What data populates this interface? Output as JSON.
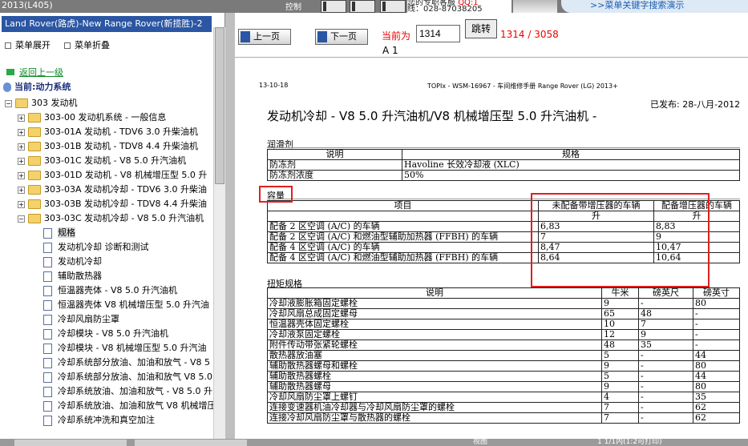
{
  "window": {
    "title": "2013(L405)",
    "control_label": "控制"
  },
  "ad": {
    "line1": "您的专职客服",
    "qq": "QQ:1",
    "line2": "线：028-87038205",
    "link": ">>菜单关键字搜索演示"
  },
  "left": {
    "header": "Land Rover(路虎)-New Range Rover(新揽胜)-2",
    "expand_label": "菜单展开",
    "collapse_label": "菜单折叠",
    "back_label": "返回上一级",
    "current_label": "当前:动力系统",
    "tree": [
      {
        "label": "303 发动机",
        "type": "folder",
        "open": true,
        "indent": 0
      },
      {
        "label": "303-00 发动机系统 - 一般信息",
        "type": "folder",
        "indent": 1
      },
      {
        "label": "303-01A 发动机 - TDV6 3.0 升柴油机",
        "type": "folder",
        "indent": 1
      },
      {
        "label": "303-01B 发动机 - TDV8 4.4 升柴油机",
        "type": "folder",
        "indent": 1
      },
      {
        "label": "303-01C 发动机 - V8 5.0 升汽油机",
        "type": "folder",
        "indent": 1
      },
      {
        "label": "303-01D 发动机 - V8 机械增压型 5.0 升",
        "type": "folder",
        "indent": 1
      },
      {
        "label": "303-03A 发动机冷却 - TDV6 3.0 升柴油",
        "type": "folder",
        "indent": 1
      },
      {
        "label": "303-03B 发动机冷却 - TDV8 4.4 升柴油",
        "type": "folder",
        "indent": 1
      },
      {
        "label": "303-03C 发动机冷却 - V8 5.0 升汽油机",
        "type": "folder",
        "open": true,
        "indent": 1
      },
      {
        "label": "规格",
        "type": "doc",
        "indent": 2,
        "selected": true
      },
      {
        "label": "发动机冷却 诊断和测试",
        "type": "doc",
        "indent": 2
      },
      {
        "label": "发动机冷却",
        "type": "doc",
        "indent": 2
      },
      {
        "label": "辅助散热器",
        "type": "doc",
        "indent": 2
      },
      {
        "label": "恒温器壳体 - V8 5.0 升汽油机",
        "type": "doc",
        "indent": 2
      },
      {
        "label": "恒温器壳体 V8 机械增压型 5.0 升汽油",
        "type": "doc",
        "indent": 2
      },
      {
        "label": "冷却风扇防尘罩",
        "type": "doc",
        "indent": 2
      },
      {
        "label": "冷却模块 - V8 5.0 升汽油机",
        "type": "doc",
        "indent": 2
      },
      {
        "label": "冷却模块 - V8 机械增压型 5.0 升汽油",
        "type": "doc",
        "indent": 2
      },
      {
        "label": "冷却系统部分放油、加油和放气 - V8 5",
        "type": "doc",
        "indent": 2
      },
      {
        "label": "冷却系统部分放油、加油和放气 V8 5.0",
        "type": "doc",
        "indent": 2
      },
      {
        "label": "冷却系统放油、加油和放气 - V8 5.0 升",
        "type": "doc",
        "indent": 2
      },
      {
        "label": "冷却系统放油、加油和放气 V8 机械增压",
        "type": "doc",
        "indent": 2
      },
      {
        "label": "冷却系统冲洗和真空加注",
        "type": "doc",
        "indent": 2
      }
    ]
  },
  "nav": {
    "prev_label": "上一页",
    "next_label": "下一页",
    "current_label": "当前为",
    "page_value": "1314",
    "go_label": "跳转",
    "page_count": "1314 / 3058",
    "page_sub": "A 1"
  },
  "doc": {
    "date": "13-10-18",
    "header": "TOPIx - WSM-16967 - 车间维修手册 Range Rover (LG) 2013+",
    "published": "已发布: 28-八月-2012",
    "title": "发动机冷却 - V8 5.0 升汽油机/V8 机械增压型 5.0 升汽油机 -",
    "lubricant": {
      "heading": "润滑剂",
      "headers": [
        "说明",
        "规格"
      ],
      "rows": [
        [
          "防冻剂",
          "Havoline 长效冷却液 (XLC)"
        ],
        [
          "防冻剂浓度",
          "50%"
        ]
      ]
    },
    "capacity": {
      "heading": "容量",
      "headers": [
        "项目",
        "未配备带增压器的车辆",
        "配备增压器的车辆"
      ],
      "units": [
        "升",
        "升"
      ],
      "rows": [
        [
          "配备 2 区空调 (A/C) 的车辆",
          "6,83",
          "8,83"
        ],
        [
          "配备 2 区空调 (A/C) 和燃油型辅助加热器 (FFBH) 的车辆",
          "7",
          "9"
        ],
        [
          "配备 4 区空调 (A/C) 的车辆",
          "8,47",
          "10,47"
        ],
        [
          "配备 4 区空调 (A/C) 和燃油型辅助加热器 (FFBH) 的车辆",
          "8,64",
          "10,64"
        ]
      ]
    },
    "torque": {
      "heading": "扭矩规格",
      "headers": [
        "说明",
        "牛米",
        "磅英尺",
        "磅英寸"
      ],
      "rows": [
        [
          "冷却液膨胀箱固定螺栓",
          "9",
          "-",
          "80"
        ],
        [
          "冷却风扇总成固定螺母",
          "65",
          "48",
          "-"
        ],
        [
          "恒温器壳体固定螺栓",
          "10",
          "7",
          "-"
        ],
        [
          "冷却液泵固定螺栓",
          "12",
          "9",
          "-"
        ],
        [
          "附件传动带张紧轮螺栓",
          "48",
          "35",
          "-"
        ],
        [
          "散热器放油塞",
          "5",
          "-",
          "44"
        ],
        [
          "辅助散热器螺母和螺栓",
          "9",
          "-",
          "80"
        ],
        [
          "辅助散热器螺栓",
          "5",
          "-",
          "44"
        ],
        [
          "辅助散热器螺母",
          "9",
          "-",
          "80"
        ],
        [
          "冷却风扇防尘罩上螺钉",
          "4",
          "-",
          "35"
        ],
        [
          "连接变速器机油冷却器与冷却风扇防尘罩的螺栓",
          "7",
          "-",
          "62"
        ],
        [
          "连接冷却风扇防尘罩与散热器的螺栓",
          "7",
          "-",
          "62"
        ]
      ]
    }
  },
  "status": {
    "view_label": "视图",
    "page_info": "1  1/1内(1:2可打印)"
  }
}
